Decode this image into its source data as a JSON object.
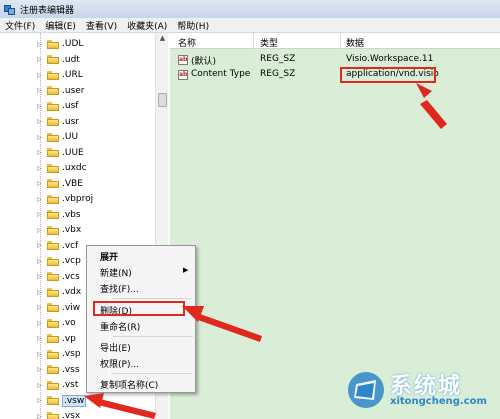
{
  "window": {
    "title": "注册表编辑器"
  },
  "menubar": [
    "文件(F)",
    "编辑(E)",
    "查看(V)",
    "收藏夹(A)",
    "帮助(H)"
  ],
  "tree": {
    "items": [
      ".UDL",
      ".udt",
      ".URL",
      ".user",
      ".usf",
      ".usr",
      ".UU",
      ".UUE",
      ".uxdc",
      ".VBE",
      ".vbproj",
      ".vbs",
      ".vbx",
      ".vcf",
      ".vcp",
      ".vcs",
      ".vdx",
      ".viw",
      ".vo",
      ".vp",
      ".vsp",
      ".vss",
      ".vst",
      ".vsw",
      ".vsx"
    ],
    "selected_index": 23
  },
  "list": {
    "columns": [
      "名称",
      "类型",
      "数据"
    ],
    "rows": [
      {
        "name": "(默认)",
        "type": "REG_SZ",
        "data": "Visio.Workspace.11"
      },
      {
        "name": "Content Type",
        "type": "REG_SZ",
        "data": "application/vnd.visio"
      }
    ]
  },
  "context_menu": {
    "items": [
      "展开",
      "新建(N)",
      "查找(F)...",
      "删除(D)",
      "重命名(R)",
      "导出(E)",
      "权限(P)...",
      "复制项名称(C)"
    ],
    "highlighted": "删除(D)"
  },
  "watermark": {
    "name": "系统城",
    "url": "xitongcheng.com"
  },
  "colors": {
    "list_bg": "#d9edd7",
    "highlight": "#e0281e",
    "accent": "#2e86c9"
  }
}
